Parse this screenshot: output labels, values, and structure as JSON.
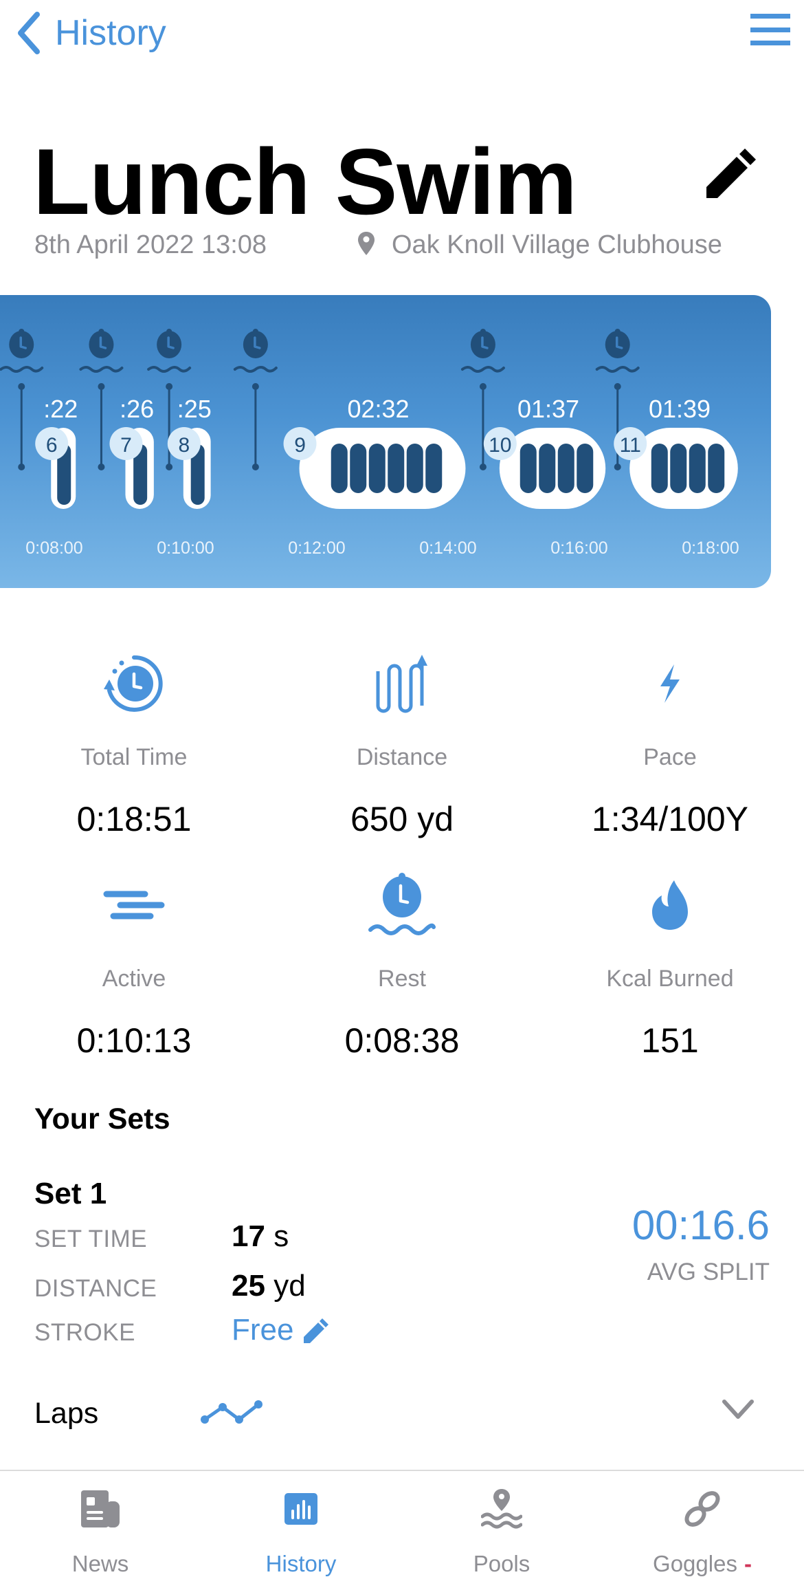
{
  "nav": {
    "back_label": "History",
    "back_icon": "chevron-left-icon",
    "menu_icon": "hamburger-menu-icon"
  },
  "workout": {
    "title": "Lunch Swim",
    "edit_icon": "pencil-icon",
    "date": "8th April 2022 13:08",
    "location_icon": "map-pin-icon",
    "location": "Oak Knoll Village Clubhouse"
  },
  "colors": {
    "accent": "#4a93db",
    "chart_top": "#387cbc",
    "chart_bottom": "#7ab7e7",
    "chart_dark": "#214f7a",
    "badge_fill": "#d8ebf9",
    "muted_text": "#8e8e93",
    "alert": "#d0365a"
  },
  "chart_data": {
    "type": "timeline",
    "title": "",
    "x_unit": "seconds",
    "x_range_visible": [
      430,
      1110
    ],
    "x_ticks": [
      {
        "t": 480,
        "label": "0:08:00"
      },
      {
        "t": 600,
        "label": "0:10:00"
      },
      {
        "t": 720,
        "label": "0:12:00"
      },
      {
        "t": 840,
        "label": "0:14:00"
      },
      {
        "t": 960,
        "label": "0:16:00"
      },
      {
        "t": 1080,
        "label": "0:18:00"
      }
    ],
    "rest_markers": [
      {
        "t": 450
      },
      {
        "t": 523
      },
      {
        "t": 585
      },
      {
        "t": 664
      },
      {
        "t": 872
      },
      {
        "t": 995
      }
    ],
    "sets": [
      {
        "number": "6",
        "start": 477,
        "duration": 22,
        "label": ":22",
        "laps": 1
      },
      {
        "number": "7",
        "start": 545,
        "duration": 26,
        "label": ":26",
        "laps": 1
      },
      {
        "number": "8",
        "start": 598,
        "duration": 25,
        "label": ":25",
        "laps": 1
      },
      {
        "number": "9",
        "start": 704,
        "duration": 152,
        "label": "02:32",
        "laps": 6
      },
      {
        "number": "10",
        "start": 887,
        "duration": 97,
        "label": "01:37",
        "laps": 4
      },
      {
        "number": "11",
        "start": 1006,
        "duration": 99,
        "label": "01:39",
        "laps": 4
      }
    ]
  },
  "stats": [
    {
      "icon": "clock-rewind-icon",
      "label": "Total Time",
      "value": "0:18:51"
    },
    {
      "icon": "lane-distance-icon",
      "label": "Distance",
      "value": "650 yd"
    },
    {
      "icon": "lightning-bolt-icon",
      "label": "Pace",
      "value": "1:34/100Y"
    },
    {
      "icon": "active-lines-icon",
      "label": "Active",
      "value": "0:10:13"
    },
    {
      "icon": "rest-stopwatch-icon",
      "label": "Rest",
      "value": "0:08:38"
    },
    {
      "icon": "flame-icon",
      "label": "Kcal Burned",
      "value": "151"
    }
  ],
  "sets_section": {
    "heading": "Your Sets",
    "set": {
      "name": "Set 1",
      "set_time_label": "SET TIME",
      "set_time_value": "17",
      "set_time_unit": "s",
      "distance_label": "DISTANCE",
      "distance_value": "25",
      "distance_unit": "yd",
      "stroke_label": "STROKE",
      "stroke_value": "Free",
      "avg_split_value": "00:16.6",
      "avg_split_label": "AVG SPLIT"
    },
    "laps_label": "Laps"
  },
  "tabbar": {
    "tabs": [
      {
        "label": "News",
        "icon": "newspaper-icon",
        "active": false
      },
      {
        "label": "History",
        "icon": "bar-chart-icon",
        "active": true
      },
      {
        "label": "Pools",
        "icon": "pool-location-icon",
        "active": false
      },
      {
        "label": "Goggles",
        "icon": "link-chain-icon",
        "active": false,
        "status": "-"
      }
    ]
  }
}
